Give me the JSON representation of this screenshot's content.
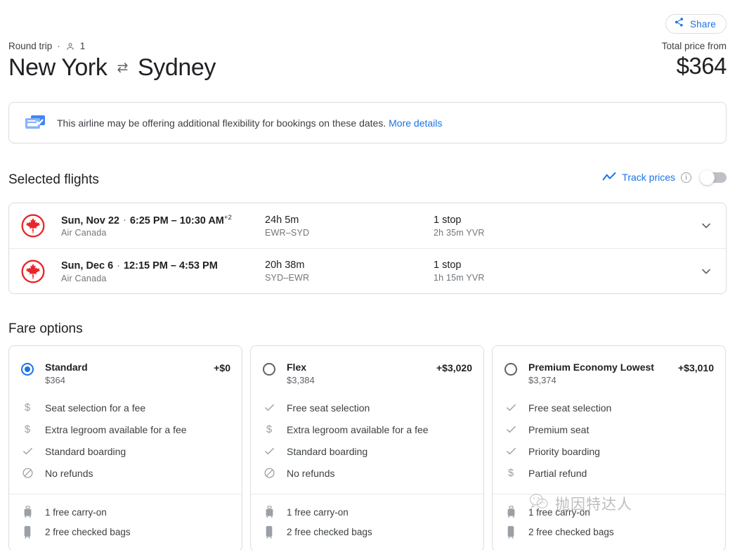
{
  "share": {
    "label": "Share",
    "icon": "share-icon"
  },
  "header": {
    "trip_type": "Round trip",
    "separator": "·",
    "passenger_icon": "person-icon",
    "passengers": "1",
    "origin": "New York",
    "swap_icon": "⇄",
    "destination": "Sydney"
  },
  "price": {
    "label": "Total price from",
    "value": "$364"
  },
  "banner": {
    "icon": "flexible-booking-icon",
    "text": "This airline may be offering additional flexibility for bookings on these dates.",
    "link": "More details"
  },
  "selected_flights": {
    "title": "Selected flights",
    "track_prices": {
      "icon": "trending-up-icon",
      "label": "Track prices",
      "info_icon": "info-icon",
      "info_glyph": "i",
      "toggle_on": false
    },
    "rows": [
      {
        "airline_logo": "air-canada-logo",
        "date": "Sun, Nov 22",
        "dot": "·",
        "times": "6:25 PM – 10:30 AM",
        "day_offset": "+2",
        "airline": "Air Canada",
        "duration": "24h 5m",
        "route": "EWR–SYD",
        "stops": "1 stop",
        "layover": "2h 35m YVR",
        "expand_icon": "chevron-down-icon"
      },
      {
        "airline_logo": "air-canada-logo",
        "date": "Sun, Dec 6",
        "dot": "·",
        "times": "12:15 PM – 4:53 PM",
        "day_offset": "",
        "airline": "Air Canada",
        "duration": "20h 38m",
        "route": "SYD–EWR",
        "stops": "1 stop",
        "layover": "1h 15m YVR",
        "expand_icon": "chevron-down-icon"
      }
    ]
  },
  "fare_options": {
    "title": "Fare options",
    "cards": [
      {
        "selected": true,
        "name": "Standard",
        "price": "$364",
        "delta": "+$0",
        "features": [
          {
            "icon": "dollar-icon",
            "text": "Seat selection for a fee"
          },
          {
            "icon": "dollar-icon",
            "text": "Extra legroom available for a fee"
          },
          {
            "icon": "check-icon",
            "text": "Standard boarding"
          },
          {
            "icon": "no-refund-icon",
            "text": "No refunds"
          }
        ],
        "bags": [
          {
            "icon": "carry-on-icon",
            "text": "1 free carry-on"
          },
          {
            "icon": "checked-bag-icon",
            "text": "2 free checked bags"
          }
        ]
      },
      {
        "selected": false,
        "name": "Flex",
        "price": "$3,384",
        "delta": "+$3,020",
        "features": [
          {
            "icon": "check-icon",
            "text": "Free seat selection"
          },
          {
            "icon": "dollar-icon",
            "text": "Extra legroom available for a fee"
          },
          {
            "icon": "check-icon",
            "text": "Standard boarding"
          },
          {
            "icon": "no-refund-icon",
            "text": "No refunds"
          }
        ],
        "bags": [
          {
            "icon": "carry-on-icon",
            "text": "1 free carry-on"
          },
          {
            "icon": "checked-bag-icon",
            "text": "2 free checked bags"
          }
        ]
      },
      {
        "selected": false,
        "name": "Premium Economy Lowest",
        "price": "$3,374",
        "delta": "+$3,010",
        "features": [
          {
            "icon": "check-icon",
            "text": "Free seat selection"
          },
          {
            "icon": "check-icon",
            "text": "Premium seat"
          },
          {
            "icon": "check-icon",
            "text": "Priority boarding"
          },
          {
            "icon": "dollar-icon",
            "text": "Partial refund"
          }
        ],
        "bags": [
          {
            "icon": "carry-on-icon",
            "text": "1 free carry-on"
          },
          {
            "icon": "checked-bag-icon",
            "text": "2 free checked bags"
          }
        ]
      }
    ]
  },
  "watermark": {
    "icon": "wechat-icon",
    "text": "抛因特达人"
  },
  "colors": {
    "accent": "#1a73e8",
    "airline_red": "#e8262a",
    "text": "#202124",
    "muted": "#5f6368"
  }
}
